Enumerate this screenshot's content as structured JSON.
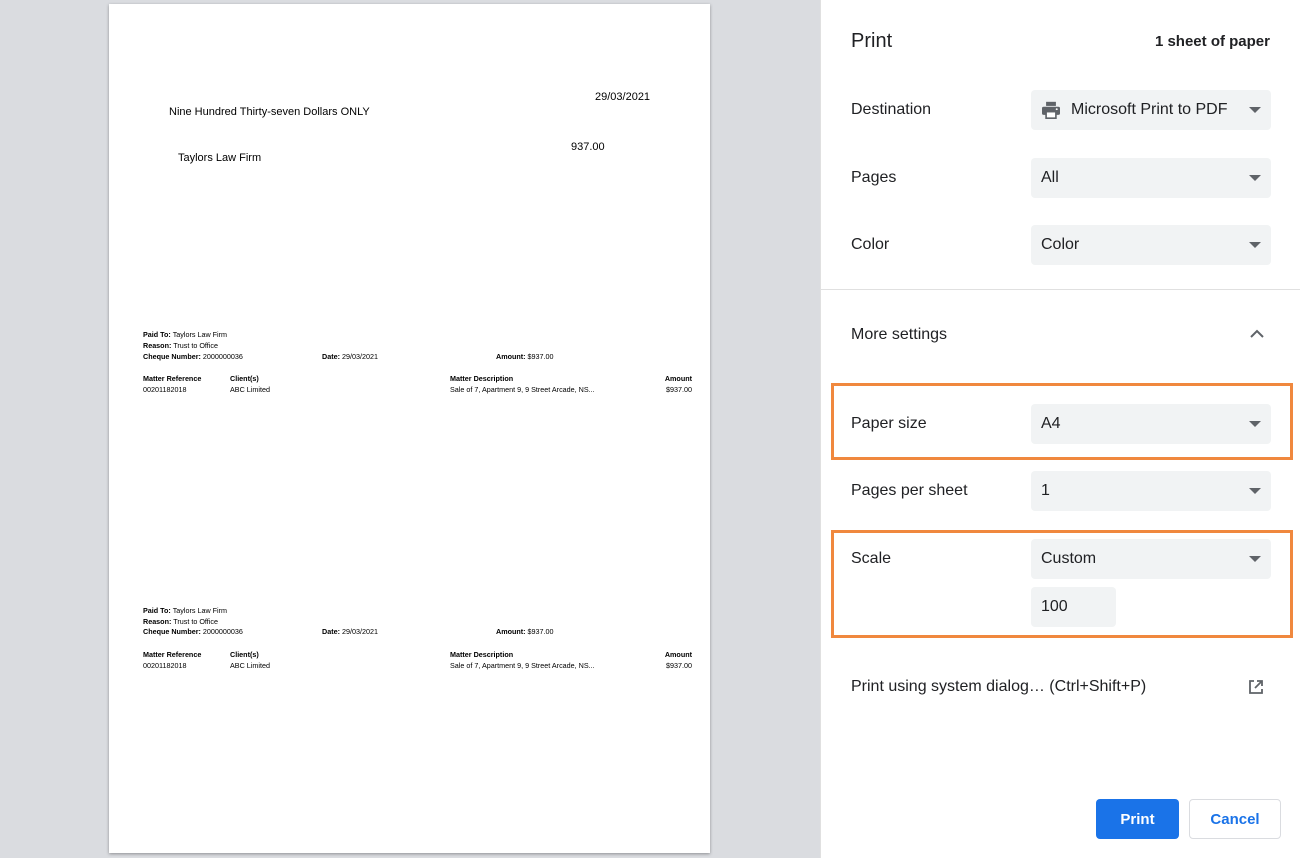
{
  "preview": {
    "cheque": {
      "date": "29/03/2021",
      "amount_words": "Nine Hundred Thirty-seven Dollars ONLY",
      "amount": "937.00",
      "payee": "Taylors Law Firm"
    },
    "remittance": [
      {
        "paid_to_label": "Paid To:",
        "paid_to": "Taylors Law Firm",
        "reason_label": "Reason:",
        "reason": "Trust to Office",
        "cheque_number_label": "Cheque Number:",
        "cheque_number": "2000000036",
        "date_label": "Date:",
        "date": "29/03/2021",
        "amount_label": "Amount:",
        "amount": "$937.00",
        "columns": [
          "Matter Reference",
          "Client(s)",
          "Matter Description",
          "Amount"
        ],
        "row": [
          "00201182018",
          "ABC Limited",
          "Sale of 7, Apartment 9, 9 Street Arcade, NS...",
          "$937.00"
        ]
      },
      {
        "paid_to_label": "Paid To:",
        "paid_to": "Taylors Law Firm",
        "reason_label": "Reason:",
        "reason": "Trust to Office",
        "cheque_number_label": "Cheque Number:",
        "cheque_number": "2000000036",
        "date_label": "Date:",
        "date": "29/03/2021",
        "amount_label": "Amount:",
        "amount": "$937.00",
        "columns": [
          "Matter Reference",
          "Client(s)",
          "Matter Description",
          "Amount"
        ],
        "row": [
          "00201182018",
          "ABC Limited",
          "Sale of 7, Apartment 9, 9 Street Arcade, NS...",
          "$937.00"
        ]
      }
    ]
  },
  "panel": {
    "title": "Print",
    "sheet_count": "1 sheet of paper",
    "destination": {
      "label": "Destination",
      "value": "Microsoft Print to PDF",
      "icon": "printer-icon"
    },
    "pages": {
      "label": "Pages",
      "value": "All"
    },
    "color": {
      "label": "Color",
      "value": "Color"
    },
    "more_settings": {
      "label": "More settings",
      "icon": "chevron-up-icon"
    },
    "paper_size": {
      "label": "Paper size",
      "value": "A4"
    },
    "pages_per_sheet": {
      "label": "Pages per sheet",
      "value": "1"
    },
    "scale": {
      "label": "Scale",
      "value": "Custom",
      "custom_value": "100"
    },
    "system_dialog": {
      "label": "Print using system dialog… (Ctrl+Shift+P)",
      "icon": "open-external-icon"
    },
    "print_label": "Print",
    "cancel_label": "Cancel"
  },
  "colors": {
    "accent": "#1a73e8",
    "highlight": "#f0883e",
    "select_bg": "#f1f3f4",
    "preview_bg": "#dadce0"
  }
}
